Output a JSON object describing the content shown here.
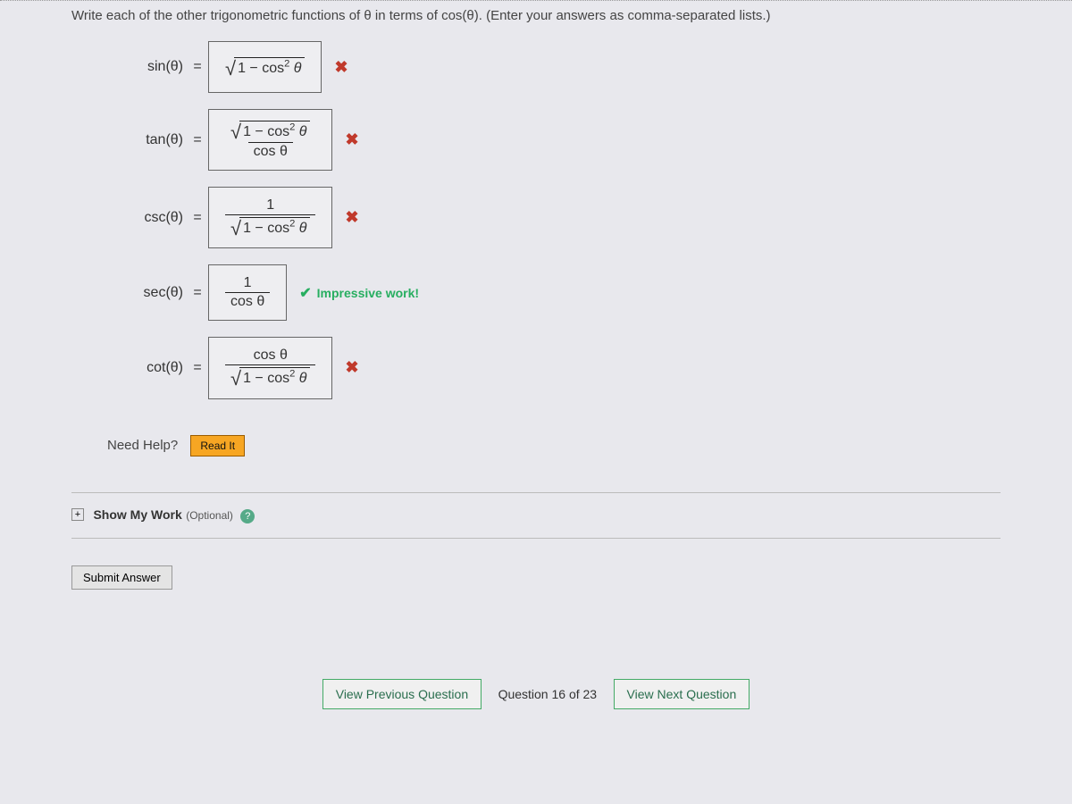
{
  "instruction": "Write each of the other trigonometric functions of θ in terms of cos(θ). (Enter your answers as comma-separated lists.)",
  "rows": {
    "sin": {
      "lhs": "sin(θ)",
      "status": "wrong"
    },
    "tan": {
      "lhs": "tan(θ)",
      "status": "wrong"
    },
    "csc": {
      "lhs": "csc(θ)",
      "status": "wrong"
    },
    "sec": {
      "lhs": "sec(θ)",
      "status": "correct",
      "msg": "Impressive work!"
    },
    "cot": {
      "lhs": "cot(θ)",
      "status": "wrong"
    }
  },
  "math_labels": {
    "one_minus_cos2": "1 − cos",
    "sup2": "2",
    "theta": "θ",
    "cos_theta": "cos θ",
    "one": "1"
  },
  "need_help": {
    "label": "Need Help?",
    "readit": "Read It"
  },
  "show_work": {
    "title": "Show My Work",
    "sub": "(Optional)"
  },
  "submit": "Submit Answer",
  "nav": {
    "prev": "View Previous Question",
    "status": "Question 16 of 23",
    "next": "View Next Question"
  },
  "feedback_icons": {
    "wrong": "✖",
    "correct": "✔"
  }
}
